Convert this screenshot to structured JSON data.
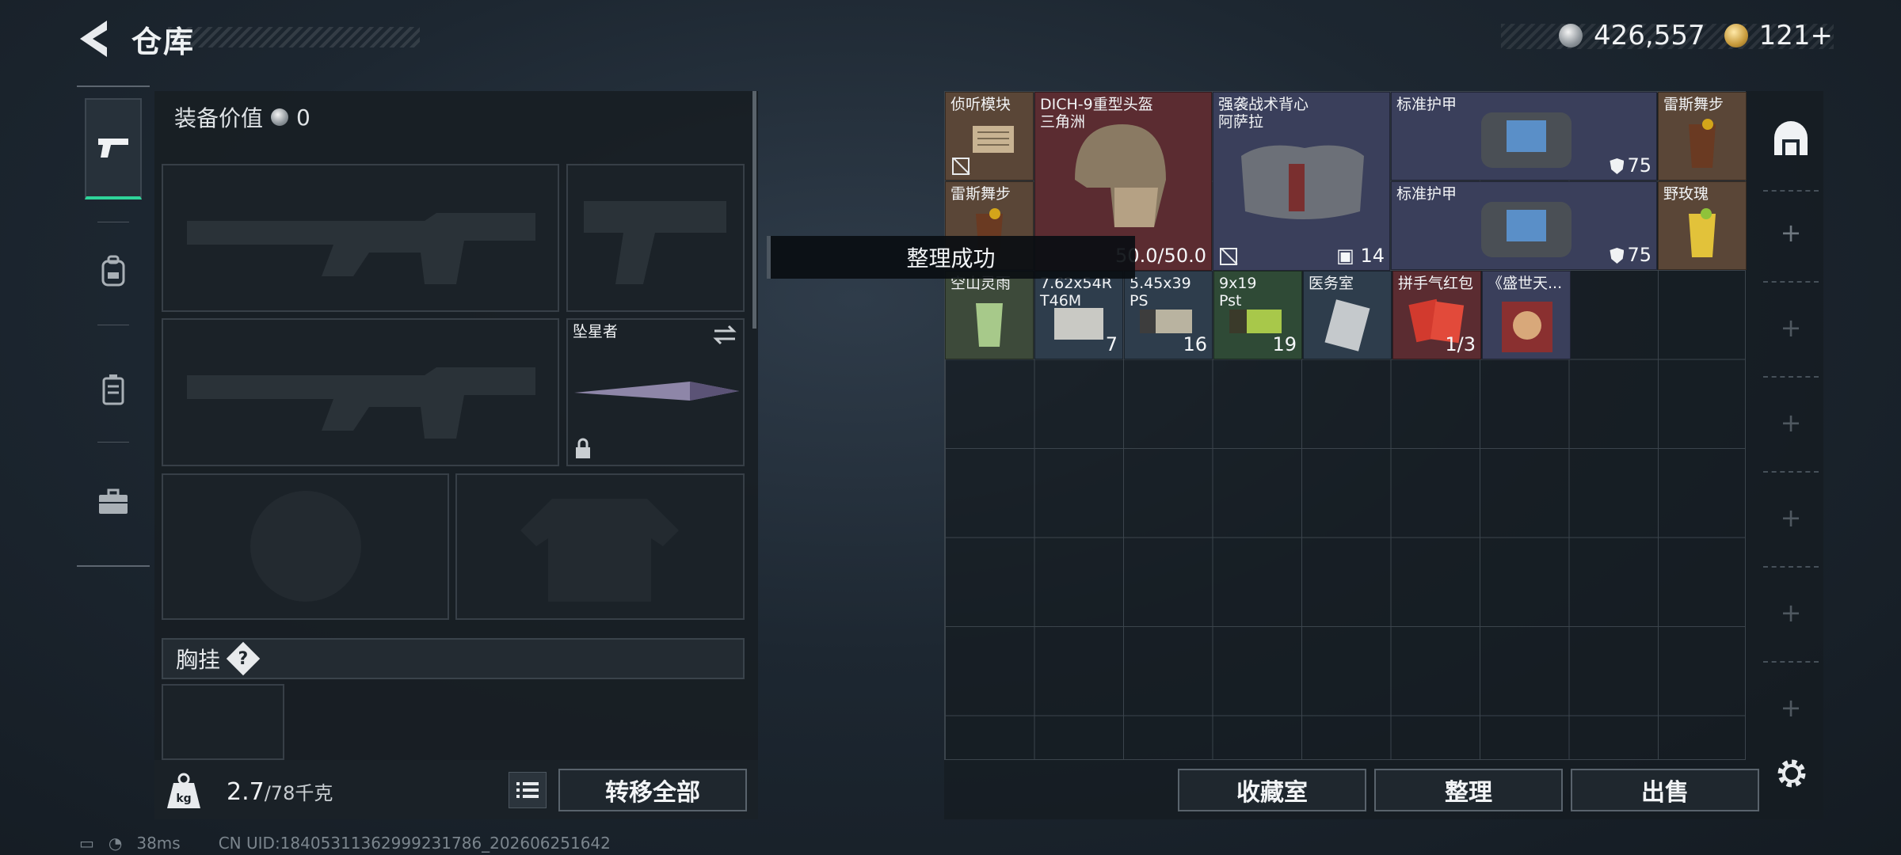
{
  "header": {
    "title": "仓库",
    "back_icon": "back-arrow-icon"
  },
  "currency": {
    "silver_amount": "426,557",
    "gold_amount": "121",
    "gold_add": "+"
  },
  "left_tabs": [
    {
      "name": "pistol-icon",
      "active": true
    },
    {
      "name": "backpack-icon",
      "active": false
    },
    {
      "name": "vest-icon",
      "active": false
    },
    {
      "name": "briefcase-icon",
      "active": false
    }
  ],
  "equipment": {
    "value_label": "装备价值",
    "value": "0",
    "melee_slot_label": "坠星者",
    "chest_label": "胸挂",
    "help": "?"
  },
  "bottom_left": {
    "weight_icon": "kg",
    "weight_value": "2.7",
    "weight_max": "/78千克",
    "transfer_all": "转移全部"
  },
  "toast": "整理成功",
  "storage_items": [
    {
      "name": "侦听模块",
      "count": "",
      "color": "#5a4637",
      "noins": true
    },
    {
      "name": "DICH-9重型头盔\n三角洲",
      "count": "50.0/50.0",
      "color": "#5b2c31"
    },
    {
      "name": "强袭战术背心\n阿萨拉",
      "count": "14",
      "color": "#3a3f5b"
    },
    {
      "name": "标准护甲",
      "count": "75",
      "color": "#3a3f5b"
    },
    {
      "name": "雷斯舞步",
      "count": "",
      "color": "#5a4637"
    },
    {
      "name": "雷斯舞步",
      "count": "",
      "color": "#5a4637"
    },
    {
      "name": "标准护甲",
      "count": "75",
      "color": "#3a3f5b"
    },
    {
      "name": "野玫瑰",
      "count": "",
      "color": "#5a4637"
    },
    {
      "name": "空山灵雨",
      "count": "",
      "color": "#3d4a3a"
    },
    {
      "name": "7.62x54R\nT46M",
      "count": "7",
      "color": "#2e3d4c"
    },
    {
      "name": "5.45x39\nPS",
      "count": "16",
      "color": "#2e3d4c"
    },
    {
      "name": "9x19\nPst",
      "count": "19",
      "color": "#2f4a36"
    },
    {
      "name": "医务室",
      "count": "",
      "color": "#2e3d4c"
    },
    {
      "name": "拼手气红包",
      "count": "1/3",
      "color": "#5b2c31"
    },
    {
      "name": "《盛世天...",
      "count": "",
      "color": "#3a3f5b"
    }
  ],
  "storage_buttons": {
    "collection": "收藏室",
    "sort": "整理",
    "sell": "出售"
  },
  "settings_icon": "gear-icon",
  "status_bar": {
    "latency": "38ms",
    "uid": "CN UID:18405311362999231786_202606251642"
  }
}
